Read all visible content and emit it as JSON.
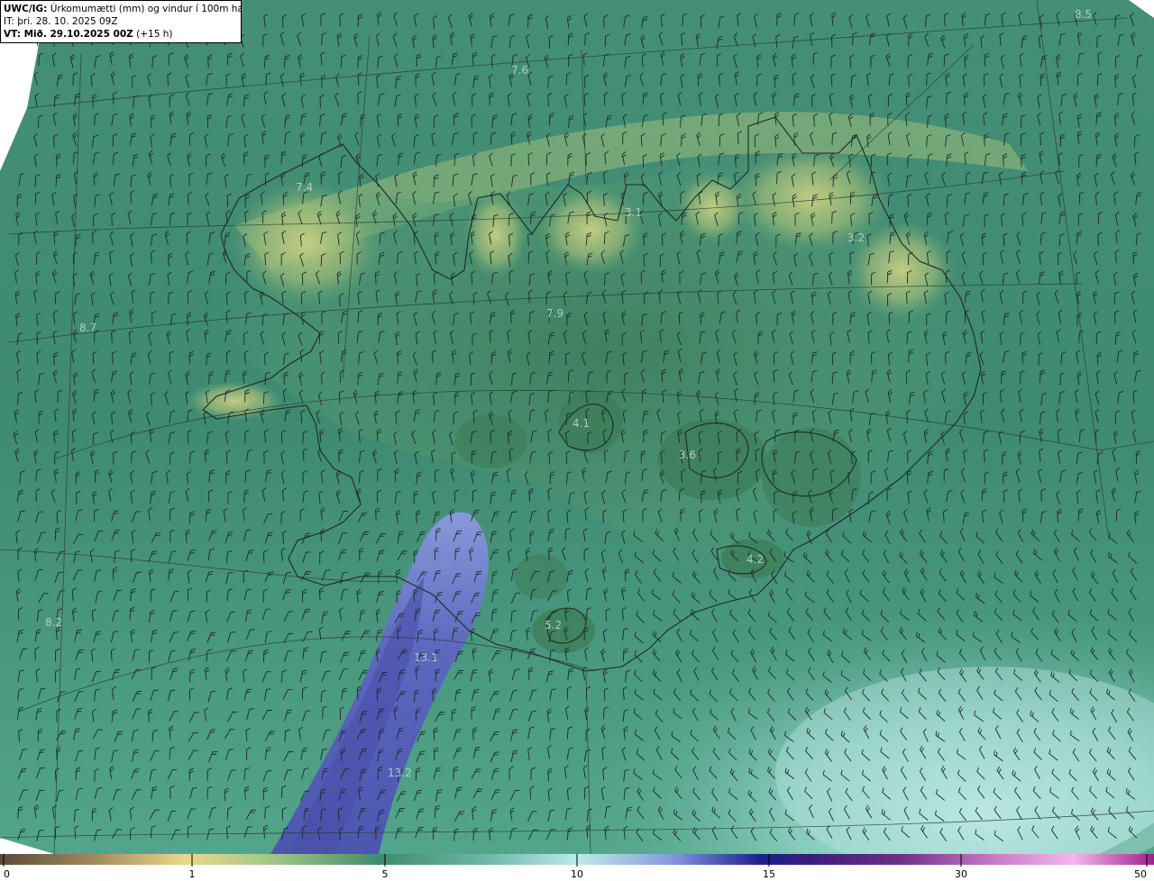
{
  "header": {
    "model_label": "UWC/IG:",
    "field_title": "Úrkomumætti (mm) og vindur í 100m hæð",
    "it_label": "IT:",
    "it_value": "þri. 28. 10. 2025 09Z",
    "vt_label": "VT: Mið. 29.10.2025 00Z",
    "vt_lead": "(+15 h)"
  },
  "map": {
    "layer_names": [
      "precipitable-water-field",
      "wind-barbs",
      "coastline",
      "graticule"
    ],
    "colors": {
      "ocean_base": "#3d8c74",
      "land_low": "#4f9a70",
      "highland_yellow": "#a7c07a",
      "high_pw_light": "#b7e6e0",
      "high_pw_blue": "#6a74c6",
      "high_pw_dark_blue": "#4a4faa",
      "coastline": "#1c2a22",
      "graticule": "#2a3a33",
      "barb": "#1e2a24"
    },
    "value_labels": [
      "7.6",
      "7.4",
      "3.1",
      "3.2",
      "7.9",
      "4.1",
      "3.6",
      "4.2",
      "5.2",
      "13.1",
      "13.2",
      "8.2",
      "8.7",
      "8.5"
    ]
  },
  "colorbar": {
    "ticks": [
      "0",
      "1",
      "5",
      "10",
      "15",
      "30",
      "50"
    ],
    "stops": [
      {
        "pos": 0.0,
        "color": "#5d4b3a"
      },
      {
        "pos": 0.08,
        "color": "#9e8a5a"
      },
      {
        "pos": 0.16,
        "color": "#e8d98a"
      },
      {
        "pos": 0.24,
        "color": "#9fc486"
      },
      {
        "pos": 0.33,
        "color": "#3f8c6c"
      },
      {
        "pos": 0.42,
        "color": "#6bb7a6"
      },
      {
        "pos": 0.5,
        "color": "#bfe9e8"
      },
      {
        "pos": 0.58,
        "color": "#8a9be0"
      },
      {
        "pos": 0.66,
        "color": "#1c1f8c"
      },
      {
        "pos": 0.7,
        "color": "#3a1e7a"
      },
      {
        "pos": 0.78,
        "color": "#6f2f8a"
      },
      {
        "pos": 0.86,
        "color": "#c778c9"
      },
      {
        "pos": 0.93,
        "color": "#f2b7ec"
      },
      {
        "pos": 1.0,
        "color": "#a0208f"
      }
    ]
  }
}
